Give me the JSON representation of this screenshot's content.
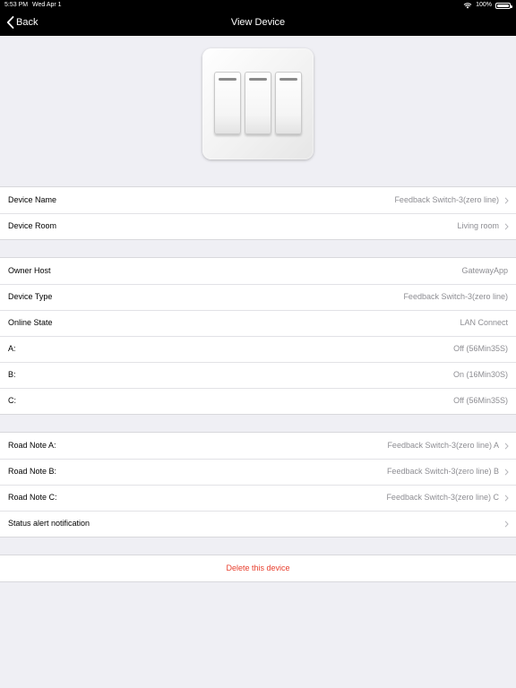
{
  "status": {
    "time": "5:53 PM",
    "date": "Wed Apr 1",
    "battery": "100%"
  },
  "nav": {
    "back_label": "Back",
    "title": "View Device"
  },
  "device_info": [
    {
      "label": "Device Name",
      "value": "Feedback Switch-3(zero line)"
    },
    {
      "label": "Device Room",
      "value": "Living room"
    }
  ],
  "details": [
    {
      "label": "Owner Host",
      "value": "GatewayApp"
    },
    {
      "label": "Device Type",
      "value": "Feedback Switch-3(zero line)"
    },
    {
      "label": "Online State",
      "value": "LAN Connect"
    },
    {
      "label": "A:",
      "value": "Off (56Min35S)"
    },
    {
      "label": "B:",
      "value": "On (16Min30S)"
    },
    {
      "label": "C:",
      "value": "Off (56Min35S)"
    }
  ],
  "road_notes": [
    {
      "label": "Road Note A:",
      "value": "Feedback Switch-3(zero line) A"
    },
    {
      "label": "Road Note B:",
      "value": "Feedback Switch-3(zero line) B"
    },
    {
      "label": "Road Note C:",
      "value": "Feedback Switch-3(zero line) C"
    },
    {
      "label": "Status alert notification",
      "value": ""
    }
  ],
  "delete_label": "Delete this device",
  "colors": {
    "nav_bg": "#000000",
    "delete": "#e8402f",
    "background": "#efeff4",
    "value_text": "#8e8e93"
  }
}
